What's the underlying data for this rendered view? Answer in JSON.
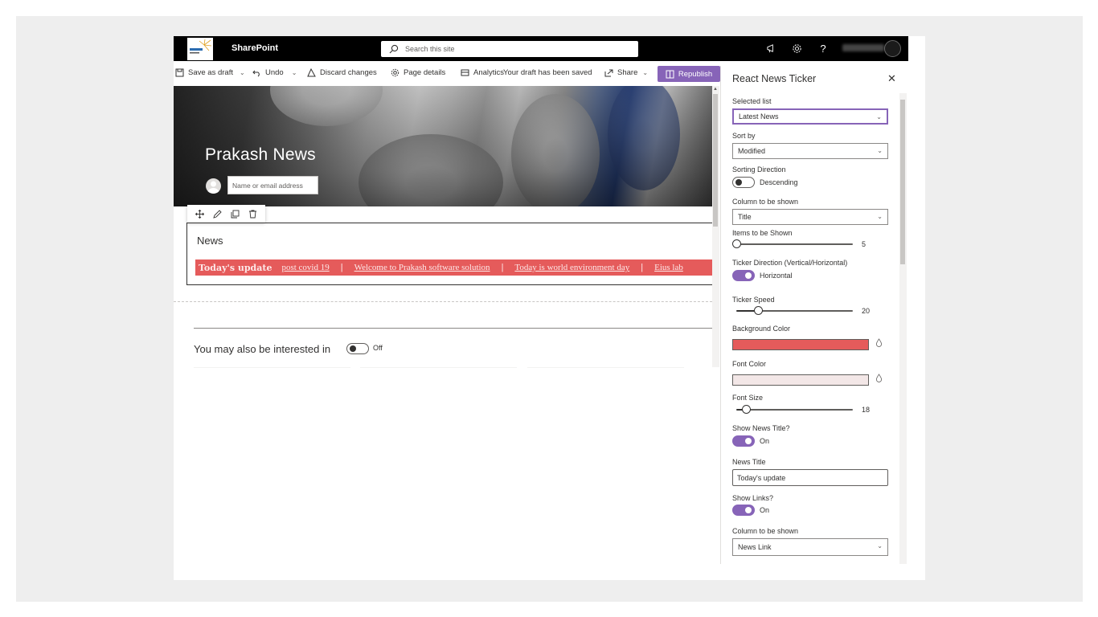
{
  "suite_bar": {
    "app_name": "SharePoint",
    "search_placeholder": "Search this site",
    "user_name": "Rushil Shah"
  },
  "command_bar": {
    "save_as_draft": "Save as draft",
    "undo": "Undo",
    "discard_changes": "Discard changes",
    "page_details": "Page details",
    "analytics": "Analytics",
    "save_status": "Your draft has been saved",
    "share": "Share",
    "republish": "Republish"
  },
  "hero": {
    "title": "Prakash News",
    "author_placeholder": "Name or email address"
  },
  "news_webpart": {
    "label": "News",
    "ticker_title": "Today's update",
    "ticker_items": [
      "post covid 19",
      "Welcome to Prakash software solution",
      "Today is world environment day",
      "Eius lab"
    ],
    "background_color": "#e55b5b",
    "font_color": "#f3e7e7"
  },
  "also_interested": {
    "label": "You may also be interested in",
    "toggle_state": "Off"
  },
  "property_pane": {
    "title": "React News Ticker",
    "selected_list_label": "Selected list",
    "selected_list_value": "Latest News",
    "sort_by_label": "Sort by",
    "sort_by_value": "Modified",
    "sorting_direction_label": "Sorting Direction",
    "sorting_direction_value": "Descending",
    "column_shown_label": "Column to be shown",
    "column_shown_value": "Title",
    "items_shown_label": "Items to be Shown",
    "items_shown_value": "5",
    "ticker_direction_label": "Ticker Direction (Vertical/Horizontal)",
    "ticker_direction_value": "Horizontal",
    "ticker_speed_label": "Ticker Speed",
    "ticker_speed_value": "20",
    "background_color_label": "Background Color",
    "font_color_label": "Font Color",
    "font_size_label": "Font Size",
    "font_size_value": "18",
    "show_news_title_label": "Show News Title?",
    "show_news_title_value": "On",
    "news_title_label": "News Title",
    "news_title_value": "Today's update",
    "show_links_label": "Show Links?",
    "show_links_value": "On",
    "link_column_label": "Column to be shown",
    "link_column_value": "News Link"
  },
  "colors": {
    "accent": "#8764b8",
    "ticker_bg": "#e55b5b",
    "suite_bar": "#000000"
  }
}
